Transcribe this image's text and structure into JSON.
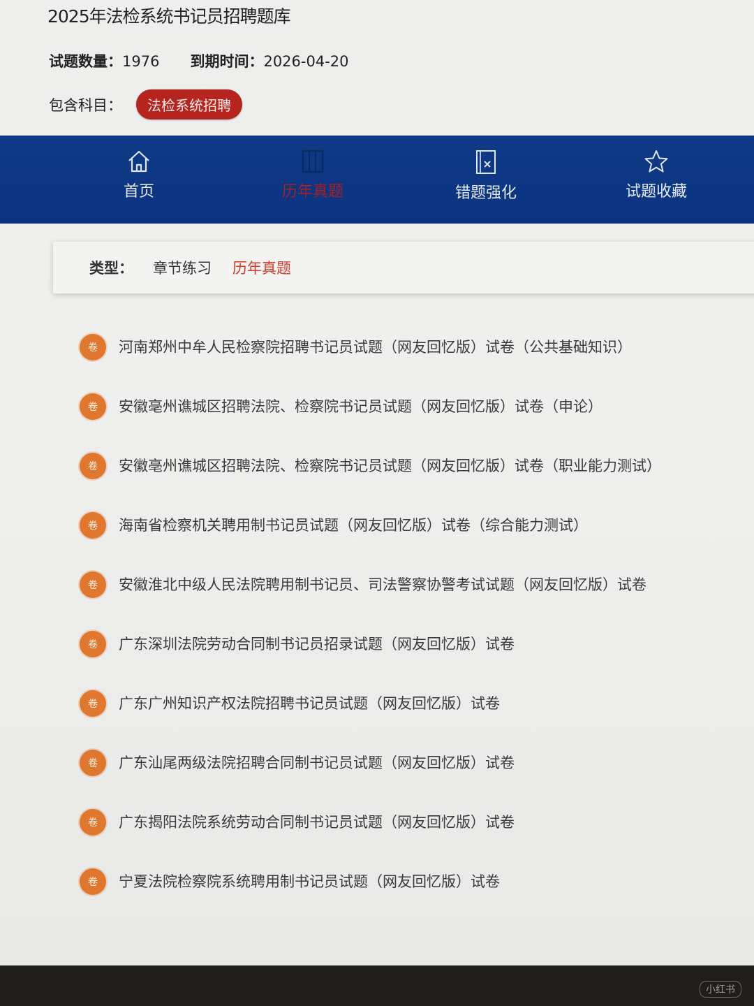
{
  "header": {
    "title": "2025年法检系统书记员招聘题库",
    "count_label": "试题数量：",
    "count_value": "1976",
    "expire_label": "到期时间：",
    "expire_value": "2026-04-20",
    "subject_label": "包含科目：",
    "subject_tag": "法检系统招聘"
  },
  "nav": {
    "items": [
      {
        "label": "首页",
        "icon": "home-icon"
      },
      {
        "label": "历年真题",
        "icon": "exam-paper-icon",
        "active": true
      },
      {
        "label": "错题强化",
        "icon": "wrong-question-icon"
      },
      {
        "label": "试题收藏",
        "icon": "star-icon"
      }
    ]
  },
  "filter": {
    "label": "类型：",
    "options": [
      "章节练习",
      "历年真题"
    ],
    "selected": "历年真题"
  },
  "exams": {
    "badge": "卷",
    "items": [
      "河南郑州中牟人民检察院招聘书记员试题（网友回忆版）试卷（公共基础知识）",
      "安徽亳州谯城区招聘法院、检察院书记员试题（网友回忆版）试卷（申论）",
      "安徽亳州谯城区招聘法院、检察院书记员试题（网友回忆版）试卷（职业能力测试）",
      "海南省检察机关聘用制书记员试题（网友回忆版）试卷（综合能力测试）",
      "安徽淮北中级人民法院聘用制书记员、司法警察协警考试试题（网友回忆版）试卷",
      "广东深圳法院劳动合同制书记员招录试题（网友回忆版）试卷",
      "广东广州知识产权法院招聘书记员试题（网友回忆版）试卷",
      "广东汕尾两级法院招聘合同制书记员试题（网友回忆版）试卷",
      "广东揭阳法院系统劳动合同制书记员试题（网友回忆版）试卷",
      "宁夏法院检察院系统聘用制书记员试题（网友回忆版）试卷"
    ]
  },
  "colors": {
    "nav_bg": "#0f3a86",
    "tag_red": "#b5241f",
    "active_red": "#d53b2b",
    "badge_orange": "#e0772e"
  }
}
